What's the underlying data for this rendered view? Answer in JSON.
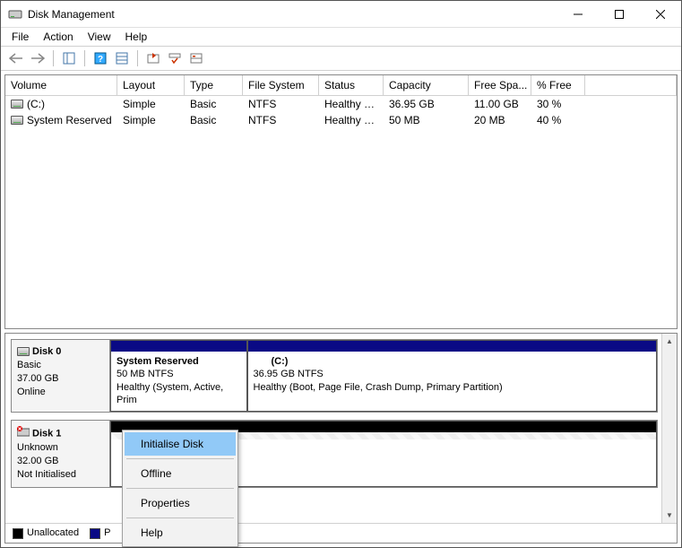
{
  "title": "Disk Management",
  "menu": {
    "file": "File",
    "action": "Action",
    "view": "View",
    "help": "Help"
  },
  "columns": {
    "volume": "Volume",
    "layout": "Layout",
    "type": "Type",
    "fs": "File System",
    "status": "Status",
    "capacity": "Capacity",
    "free": "Free Spa...",
    "pfree": "% Free"
  },
  "volumes": [
    {
      "name": "(C:)",
      "layout": "Simple",
      "type": "Basic",
      "fs": "NTFS",
      "status": "Healthy (B...",
      "capacity": "36.95 GB",
      "free": "11.00 GB",
      "pfree": "30 %"
    },
    {
      "name": "System Reserved",
      "layout": "Simple",
      "type": "Basic",
      "fs": "NTFS",
      "status": "Healthy (S...",
      "capacity": "50 MB",
      "free": "20 MB",
      "pfree": "40 %"
    }
  ],
  "disk0": {
    "label": "Disk 0",
    "type": "Basic",
    "size": "37.00 GB",
    "status": "Online",
    "part0": {
      "name": "System Reserved",
      "size": "50 MB NTFS",
      "status": "Healthy (System, Active, Prim"
    },
    "part1": {
      "name": "(C:)",
      "size": "36.95 GB NTFS",
      "status": "Healthy (Boot, Page File, Crash Dump, Primary Partition)"
    }
  },
  "disk1": {
    "label": "Disk 1",
    "type": "Unknown",
    "size": "32.00 GB",
    "status": "Not Initialised"
  },
  "legend": {
    "unallocated": "Unallocated",
    "primary": "P"
  },
  "context": {
    "init": "Initialise Disk",
    "offline": "Offline",
    "props": "Properties",
    "help": "Help"
  }
}
